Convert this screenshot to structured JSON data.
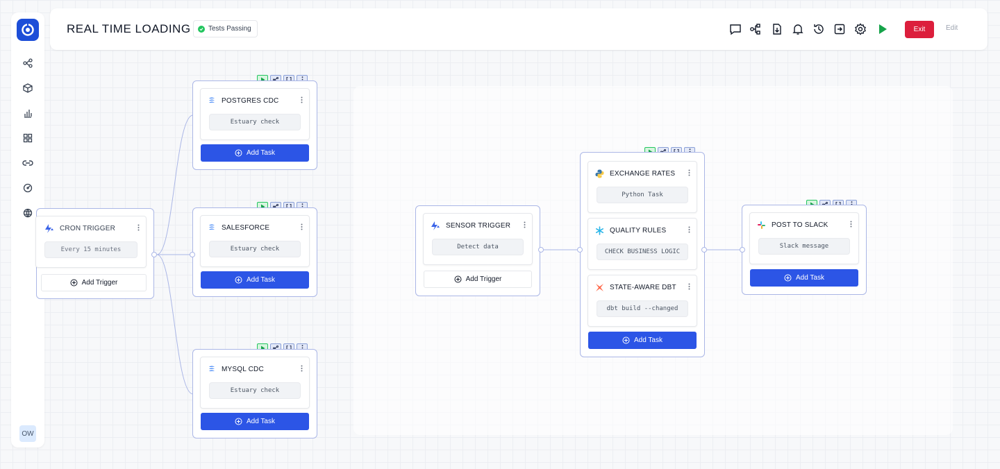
{
  "header": {
    "title": "REAL TIME LOADING",
    "status_badge": "Tests Passing",
    "exit_label": "Exit",
    "edit_label": "Edit",
    "icons": [
      "comment-icon",
      "graph-icon",
      "download-icon",
      "bell-icon",
      "history-icon",
      "export-icon",
      "settings-icon",
      "run-icon"
    ]
  },
  "sidebar": {
    "items": [
      "flow-icon",
      "package-icon",
      "chart-icon",
      "grid-icon",
      "link-icon",
      "dashboard-icon",
      "plugin-icon"
    ],
    "avatar": "OW"
  },
  "colors": {
    "accent": "#2c55e6",
    "exit": "#dc1e3c",
    "success": "#22c55e",
    "edge": "#aab6e6"
  },
  "nodes": {
    "cron": {
      "title": "CRON TRIGGER",
      "sub": "Every 15 minutes",
      "button": "Add Trigger"
    },
    "postgres": {
      "title": "POSTGRES CDC",
      "sub": "Estuary check",
      "button": "Add Task"
    },
    "salesforce": {
      "title": "SALESFORCE",
      "sub": "Estuary check",
      "button": "Add Task"
    },
    "mysql": {
      "title": "MYSQL CDC",
      "sub": "Estuary check",
      "button": "Add Task"
    },
    "sensor": {
      "title": "SENSOR TRIGGER",
      "sub": "Detect data",
      "button": "Add Trigger"
    },
    "exchange": {
      "title": "EXCHANGE RATES",
      "sub": "Python Task"
    },
    "quality": {
      "title": "QUALITY RULES",
      "sub": "CHECK BUSINESS LOGIC"
    },
    "dbt": {
      "title": "STATE-AWARE DBT",
      "sub": "dbt build --changed",
      "button": "Add Task"
    },
    "slack": {
      "title": "POST TO SLACK",
      "sub": "Slack message",
      "button": "Add Task"
    }
  }
}
